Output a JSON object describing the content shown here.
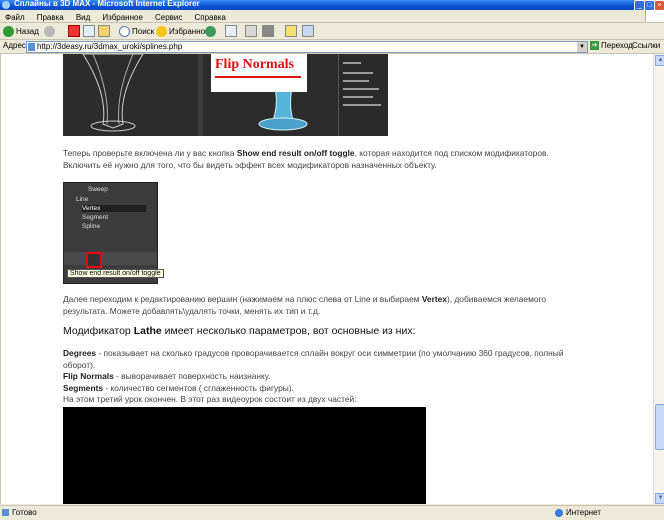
{
  "window": {
    "title": "Сплайны в 3D MAX - Microsoft Internet Explorer"
  },
  "menu": [
    "Файл",
    "Правка",
    "Вид",
    "Избранное",
    "Сервис",
    "Справка"
  ],
  "toolbar": {
    "back": "Назад",
    "search": "Поиск",
    "favorites": "Избранное"
  },
  "address": {
    "label": "Адрес:",
    "url": "http://3deasy.ru/3dmax_uroki/splines.php",
    "go": "Переход",
    "links": "Ссылки"
  },
  "content": {
    "image1_caption": "Flip Normals",
    "para1_pre": "Теперь проверьте включена ли у вас кнопка ",
    "para1_bold": "Show end result on/off toggle",
    "para1_post": ", которая находится под списком модификаторов.",
    "para1_line2": "Включить её нужно для того, что бы видеть эффект всех модификаторов назначенных объекту.",
    "modifier_stack": [
      "Sweep",
      "Line",
      "Vertex",
      "Segment",
      "Spline"
    ],
    "tooltip": "Show end result on/off toggle",
    "para2_pre": "Далее переходим к редактированию вершин (нажимаем на плюс слева от Line и выбираем ",
    "para2_bold": "Vertex",
    "para2_post": "), добиваемся желаемого",
    "para2_line2": "результата. Можете добавлять\\удалять точки, менять их тип и т.д.",
    "heading_pre": "Модификатор ",
    "heading_bold": "Lathe",
    "heading_post": " имеет несколько параметров, вот основные из них:",
    "degrees_label": "Degrees",
    "degrees_text": " - показывает на сколько градусов проворачивается сплайн вокруг оси симметрии (по умолчанию 360 градусов, полный",
    "degrees_text2": "оборот).",
    "flip_label": "Flip Normals",
    "flip_text": " - выворачивает поверхность наизнанку.",
    "segments_label": "Segments",
    "segments_text": " - количество сегментов ( сглаженность фигуры).",
    "end_text": "На этом третий урок окончен. В этот раз видеоурок состоит из двух частей:"
  },
  "status": {
    "left": "Готово",
    "zone": "Интернет"
  }
}
